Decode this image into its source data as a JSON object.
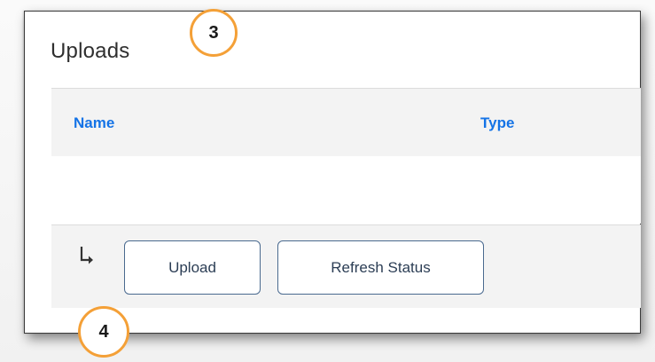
{
  "panel": {
    "title": "Uploads"
  },
  "table": {
    "columns": [
      "Name",
      "Type"
    ]
  },
  "footer": {
    "upload_label": "Upload",
    "refresh_label": "Refresh Status"
  },
  "callouts": [
    "3",
    "4"
  ],
  "icons": {
    "arrow": "return-arrow-icon"
  },
  "colors": {
    "header_link": "#1473e6",
    "callout_ring": "#f4a037",
    "button_border": "#4a6a8f"
  }
}
